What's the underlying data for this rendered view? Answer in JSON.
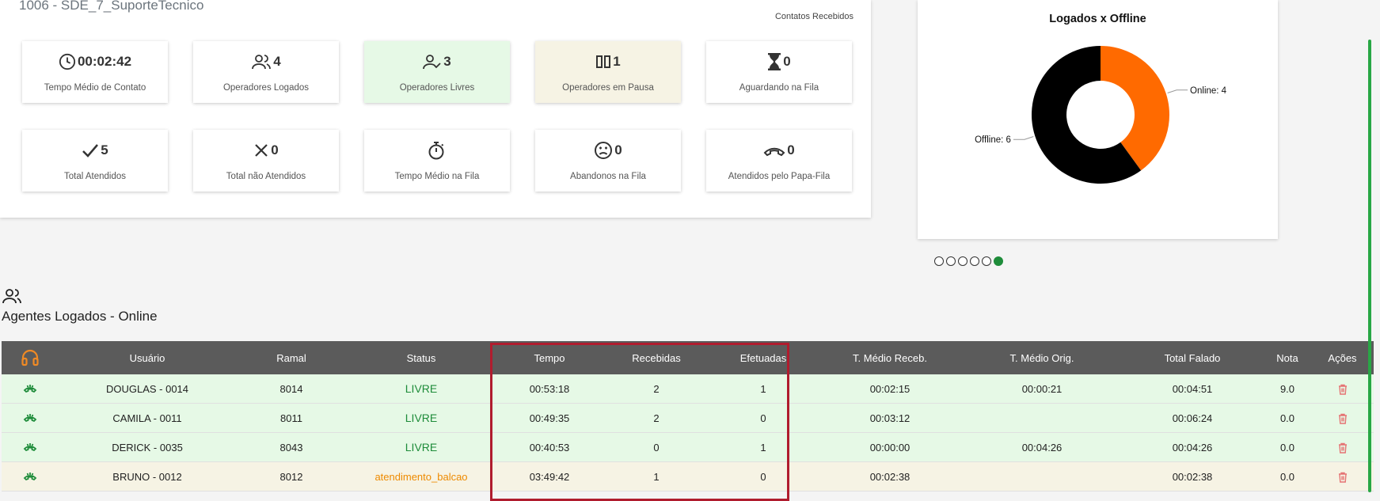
{
  "panel": {
    "title": "1006 - SDE_7_SuporteTecnico",
    "caption": "Contatos Recebidos"
  },
  "cards": [
    {
      "icon": "clock-icon",
      "value": "00:02:42",
      "label": "Tempo Médio de Contato",
      "tone": "white"
    },
    {
      "icon": "users-icon",
      "value": "4",
      "label": "Operadores Logados",
      "tone": "white"
    },
    {
      "icon": "user-check-icon",
      "value": "3",
      "label": "Operadores Livres",
      "tone": "green"
    },
    {
      "icon": "pause-icon",
      "value": "1",
      "label": "Operadores em Pausa",
      "tone": "beige"
    },
    {
      "icon": "hourglass-icon",
      "value": "0",
      "label": "Aguardando na Fila",
      "tone": "white"
    },
    {
      "icon": "check-icon",
      "value": "5",
      "label": "Total Atendidos",
      "tone": "white"
    },
    {
      "icon": "x-icon",
      "value": "0",
      "label": "Total não Atendidos",
      "tone": "white"
    },
    {
      "icon": "stopwatch-icon",
      "value": "",
      "label": "Tempo Médio na Fila",
      "tone": "white"
    },
    {
      "icon": "sad-face-icon",
      "value": "0",
      "label": "Abandonos na Fila",
      "tone": "white"
    },
    {
      "icon": "phone-hangup-icon",
      "value": "0",
      "label": "Atendidos pelo Papa-Fila",
      "tone": "white"
    }
  ],
  "chart_data": {
    "type": "pie",
    "title": "Logados x Offline",
    "categories": [
      "Online",
      "Offline"
    ],
    "values": [
      4,
      6
    ],
    "labels": [
      "Online: 4",
      "Offline: 6"
    ],
    "colors": [
      "#ff6a00",
      "#000000"
    ],
    "donut": true
  },
  "carousel": {
    "count": 6,
    "active": 5
  },
  "agents": {
    "title": "Agentes Logados - Online",
    "columns": [
      "",
      "Usuário",
      "Ramal",
      "Status",
      "Tempo",
      "Recebidas",
      "Efetuadas",
      "T. Médio Receb.",
      "T. Médio Orig.",
      "Total Falado",
      "Nota",
      "Ações"
    ],
    "rows": [
      {
        "user": "DOUGLAS - 0014",
        "ramal": "8014",
        "status": "LIVRE",
        "tempo": "00:53:18",
        "recebidas": "2",
        "efetuadas": "1",
        "tmr": "00:02:15",
        "tmo": "00:00:21",
        "total": "00:04:51",
        "nota": "9.0",
        "tone": "green"
      },
      {
        "user": "CAMILA - 0011",
        "ramal": "8011",
        "status": "LIVRE",
        "tempo": "00:49:35",
        "recebidas": "2",
        "efetuadas": "0",
        "tmr": "00:03:12",
        "tmo": "",
        "total": "00:06:24",
        "nota": "0.0",
        "tone": "green"
      },
      {
        "user": "DERICK - 0035",
        "ramal": "8043",
        "status": "LIVRE",
        "tempo": "00:40:53",
        "recebidas": "0",
        "efetuadas": "1",
        "tmr": "00:00:00",
        "tmo": "00:04:26",
        "total": "00:04:26",
        "nota": "0.0",
        "tone": "green"
      },
      {
        "user": "BRUNO - 0012",
        "ramal": "8012",
        "status": "atendimento_balcao",
        "tempo": "03:49:42",
        "recebidas": "1",
        "efetuadas": "0",
        "tmr": "00:02:38",
        "tmo": "",
        "total": "00:02:38",
        "nota": "0.0",
        "tone": "beige"
      }
    ]
  },
  "colors": {
    "accent_green": "#1e8c3a",
    "header_gray": "#5b5b5b",
    "pause_orange": "#ee8a00",
    "delete_red": "#e57373",
    "highlight_red": "#b01c2e"
  }
}
